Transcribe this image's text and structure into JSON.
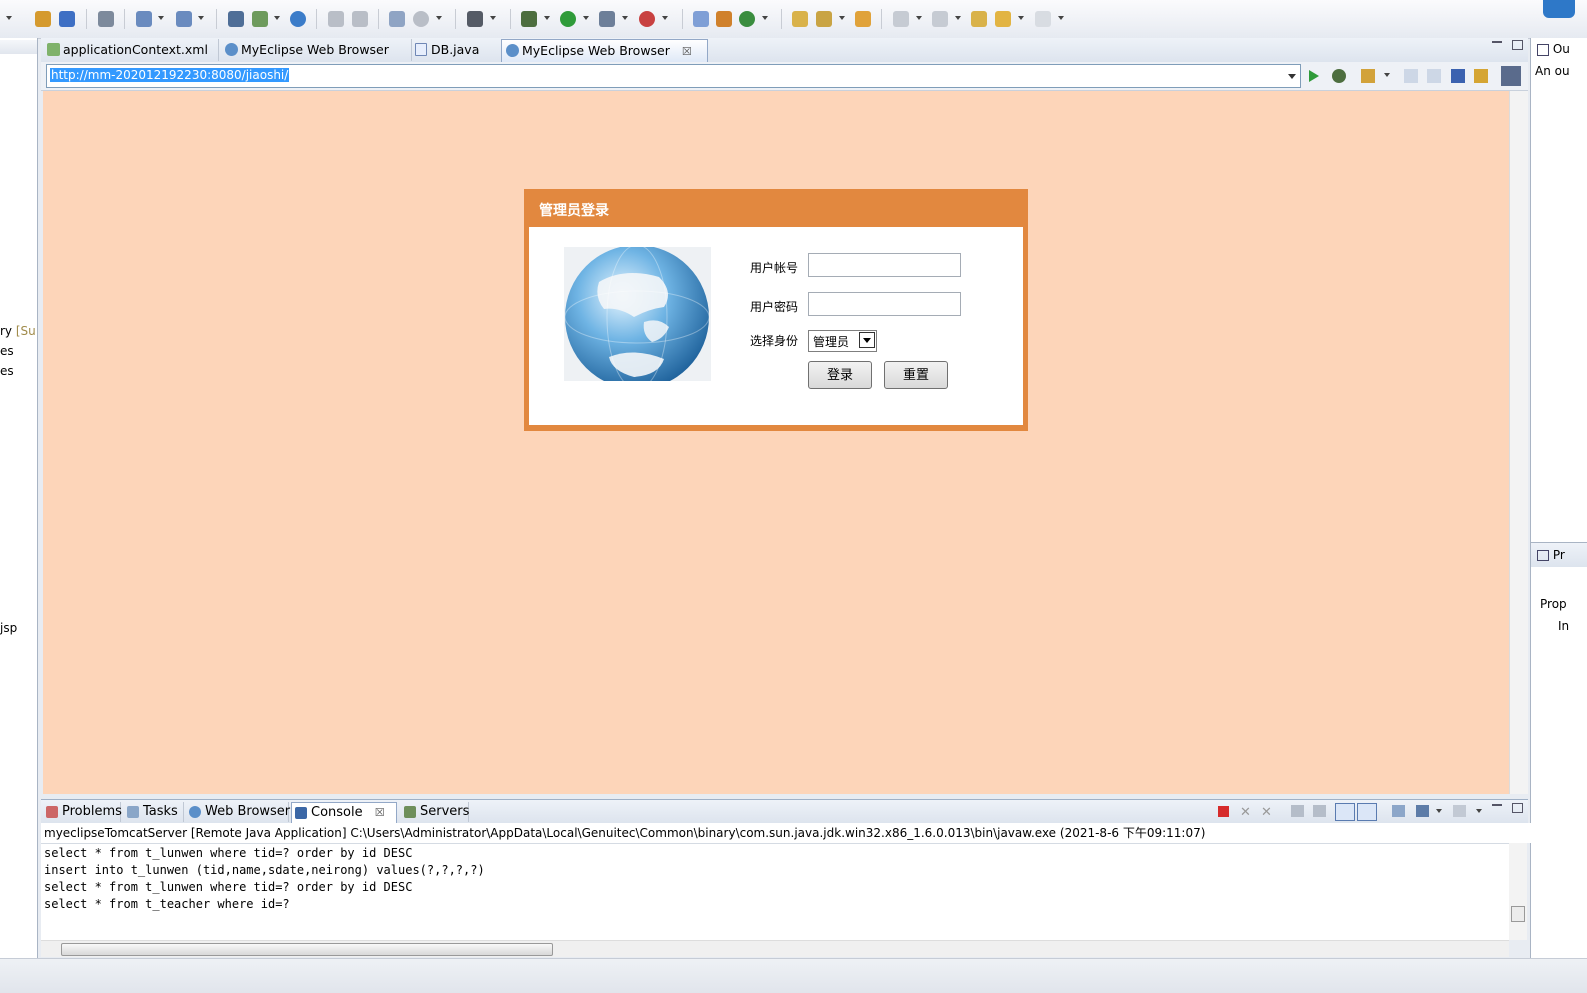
{
  "editor_tabs": [
    {
      "label": "applicationContext.xml",
      "icon": "xml-file-icon"
    },
    {
      "label": "MyEclipse Web Browser",
      "icon": "globe-icon"
    },
    {
      "label": "DB.java",
      "icon": "java-file-icon"
    },
    {
      "label": "MyEclipse Web Browser",
      "icon": "globe-icon",
      "active": true,
      "close": "☒"
    }
  ],
  "browser": {
    "url": "http://mm-202012192230:8080/jiaoshi/"
  },
  "login": {
    "title": "管理员登录",
    "username_label": "用户帐号",
    "username_value": "",
    "password_label": "用户密码",
    "password_value": "",
    "role_label": "选择身份",
    "role_value": "管理员",
    "login_button": "登录",
    "reset_button": "重置",
    "color_header": "#e2883f",
    "color_background": "#fdd5b9"
  },
  "left_panel": {
    "lines": [
      "ry",
      "[Su",
      "es",
      "es",
      "jsp"
    ]
  },
  "right_panel": {
    "outline_label": "Ou",
    "outline_text": "An ou",
    "props_label": "Pr",
    "props_col": "Prop",
    "props_row": "In"
  },
  "console": {
    "tabs": [
      {
        "label": "Problems",
        "icon": "problems-icon"
      },
      {
        "label": "Tasks",
        "icon": "tasks-icon"
      },
      {
        "label": "Web Browser",
        "icon": "globe-icon"
      },
      {
        "label": "Console",
        "icon": "console-icon",
        "active": true,
        "close": "☒"
      },
      {
        "label": "Servers",
        "icon": "servers-icon"
      }
    ],
    "header": "myeclipseTomcatServer [Remote Java Application] C:\\Users\\Administrator\\AppData\\Local\\Genuitec\\Common\\binary\\com.sun.java.jdk.win32.x86_1.6.0.013\\bin\\javaw.exe (2021-8-6 下午09:11:07)",
    "lines": [
      "select * from t_lunwen where tid=? order by id DESC",
      "insert into t_lunwen (tid,name,sdate,neirong) values(?,?,?,?)",
      "select * from t_lunwen where tid=? order by id DESC",
      "select * from t_teacher where id=?"
    ]
  }
}
